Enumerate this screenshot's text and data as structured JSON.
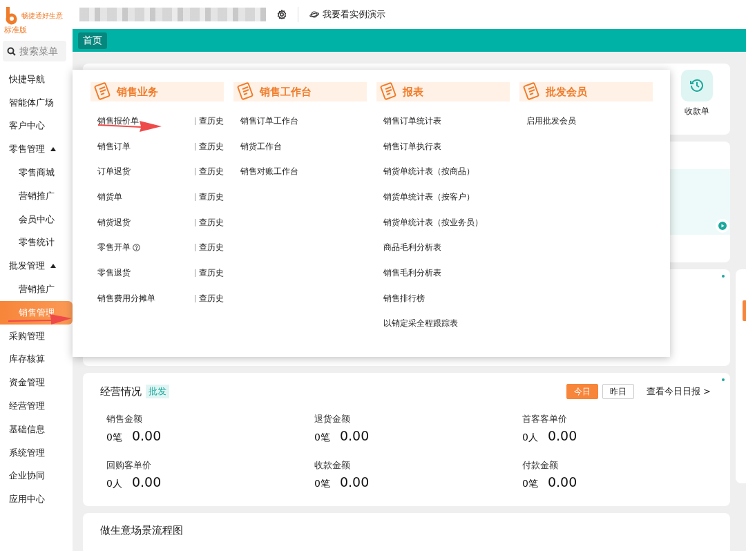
{
  "logo": {
    "brand": "畅捷通好生意",
    "edition": "标准版"
  },
  "top_bar": {
    "demo_link": "我要看实例演示"
  },
  "tabs": [
    {
      "label": "首页",
      "selected": true
    }
  ],
  "search": {
    "placeholder": "搜索菜单"
  },
  "sidebar": {
    "items": [
      {
        "label": "快捷导航",
        "selected": false
      },
      {
        "label": "智能体广场",
        "selected": false
      },
      {
        "label": "客户中心",
        "selected": false
      },
      {
        "label": "零售管理",
        "selected": false,
        "expanded": true,
        "children": [
          {
            "label": "零售商城",
            "selected": false
          },
          {
            "label": "营销推广",
            "selected": false
          },
          {
            "label": "会员中心",
            "selected": false
          },
          {
            "label": "零售统计",
            "selected": false
          }
        ]
      },
      {
        "label": "批发管理",
        "selected": false,
        "expanded": true,
        "children": [
          {
            "label": "营销推广",
            "selected": false
          },
          {
            "label": "销售管理",
            "selected": true
          }
        ]
      },
      {
        "label": "采购管理",
        "selected": false
      },
      {
        "label": "库存核算",
        "selected": false
      },
      {
        "label": "资金管理",
        "selected": false
      },
      {
        "label": "经营管理",
        "selected": false
      },
      {
        "label": "基础信息",
        "selected": false
      },
      {
        "label": "系统管理",
        "selected": false
      },
      {
        "label": "企业协同",
        "selected": false
      },
      {
        "label": "应用中心",
        "selected": false
      }
    ]
  },
  "menu_panel": {
    "columns": [
      {
        "title": "销售业务",
        "items": [
          {
            "label": "销售报价单",
            "history": "查历史",
            "help": false
          },
          {
            "label": "销售订单",
            "history": "查历史",
            "help": false
          },
          {
            "label": "订单退货",
            "history": "查历史",
            "help": false
          },
          {
            "label": "销货单",
            "history": "查历史",
            "help": false
          },
          {
            "label": "销货退货",
            "history": "查历史",
            "help": false
          },
          {
            "label": "零售开单",
            "history": "查历史",
            "help": true
          },
          {
            "label": "零售退货",
            "history": "查历史",
            "help": false
          },
          {
            "label": "销售费用分摊单",
            "history": "查历史",
            "help": false
          }
        ]
      },
      {
        "title": "销售工作台",
        "items": [
          {
            "label": "销售订单工作台",
            "help": false
          },
          {
            "label": "销货工作台",
            "help": false
          },
          {
            "label": "销售对账工作台",
            "help": false
          }
        ]
      },
      {
        "title": "报表",
        "items": [
          {
            "label": "销售订单统计表",
            "help": false
          },
          {
            "label": "销售订单执行表",
            "help": false
          },
          {
            "label": "销货单统计表（按商品）",
            "help": false
          },
          {
            "label": "销货单统计表（按客户）",
            "help": false
          },
          {
            "label": "销货单统计表（按业务员）",
            "help": false
          },
          {
            "label": "商品毛利分析表",
            "help": false
          },
          {
            "label": "销售毛利分析表",
            "help": false
          },
          {
            "label": "销售排行榜",
            "help": false
          },
          {
            "label": "以销定采全程跟踪表",
            "help": false
          }
        ]
      },
      {
        "title": "批发会员",
        "items": [
          {
            "label": "启用批发会员",
            "help": false
          }
        ]
      }
    ]
  },
  "quick_entry": {
    "label": "收款单"
  },
  "business": {
    "title": "经营情况",
    "tag": "批发",
    "periods": [
      {
        "label": "今日",
        "selected": true
      },
      {
        "label": "昨日",
        "selected": false
      }
    ],
    "report_link": "查看今日日报 >",
    "metrics": [
      {
        "label": "销售金额",
        "count": "0笔",
        "amount": "0.00"
      },
      {
        "label": "退货金额",
        "count": "0笔",
        "amount": "0.00"
      },
      {
        "label": "首客客单价",
        "count": "0人",
        "amount": "0.00"
      },
      {
        "label": "回购客单价",
        "count": "0人",
        "amount": "0.00"
      },
      {
        "label": "收款金额",
        "count": "0笔",
        "amount": "0.00"
      },
      {
        "label": "付款金额",
        "count": "0笔",
        "amount": "0.00"
      }
    ]
  },
  "flow": {
    "title": "做生意场景流程图"
  }
}
